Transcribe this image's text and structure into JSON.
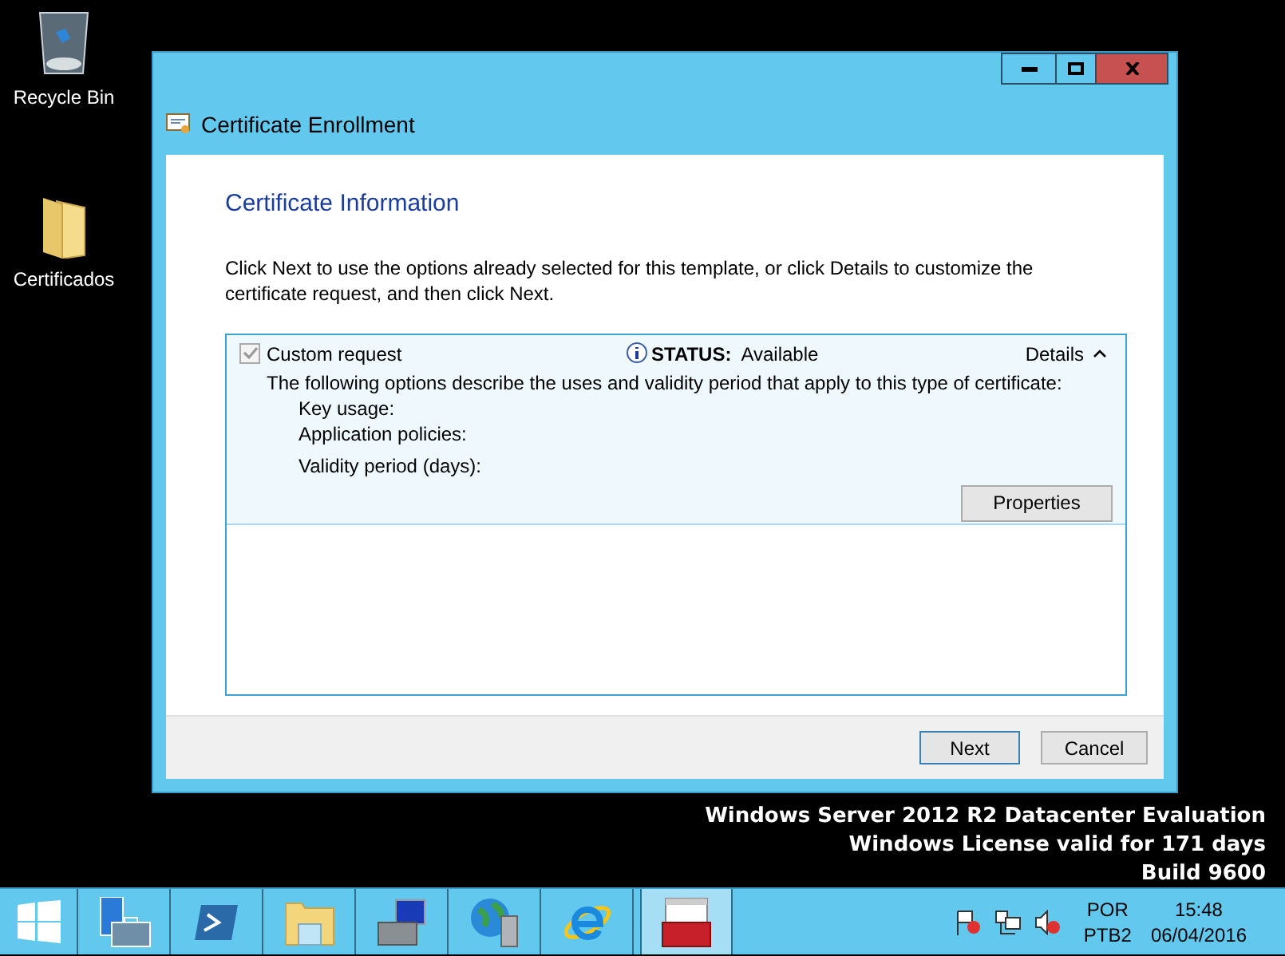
{
  "desktop_icons": [
    {
      "kind": "recycle-bin",
      "label": "Recycle Bin"
    },
    {
      "kind": "folder",
      "label": "Certificados"
    }
  ],
  "window": {
    "title": "Certificate Enrollment",
    "heading": "Certificate Information",
    "description": "Click Next to use the options already selected for this template, or click Details to customize the certificate request, and then click Next.",
    "item": {
      "checked": true,
      "label": "Custom request",
      "status_label": "STATUS:",
      "status_value": "Available",
      "details_label": "Details",
      "expanded": true,
      "description": "The following options describe the uses and validity period that apply to this type of certificate:",
      "fields": [
        "Key usage:",
        "Application policies:",
        "Validity period (days):"
      ],
      "properties_button": "Properties"
    },
    "buttons": [
      "Next",
      "Cancel"
    ]
  },
  "desktop_text": [
    "Windows Server 2012 R2 Datacenter Evaluation",
    "Windows License valid for 171 days",
    "Build 9600"
  ],
  "taskbar": {
    "items": [
      {
        "kind": "start",
        "selected": false
      },
      {
        "kind": "server-manager",
        "selected": false
      },
      {
        "kind": "powershell",
        "selected": false
      },
      {
        "kind": "file-explorer",
        "selected": false
      },
      {
        "kind": "computer-toolbox",
        "selected": false
      },
      {
        "kind": "globe-server",
        "selected": false
      },
      {
        "kind": "browser",
        "selected": false
      },
      {
        "kind": "red-toolbox",
        "selected": true
      }
    ],
    "language": "POR",
    "layout": "PTB2",
    "time": "15:48",
    "date": "06/04/2016"
  }
}
